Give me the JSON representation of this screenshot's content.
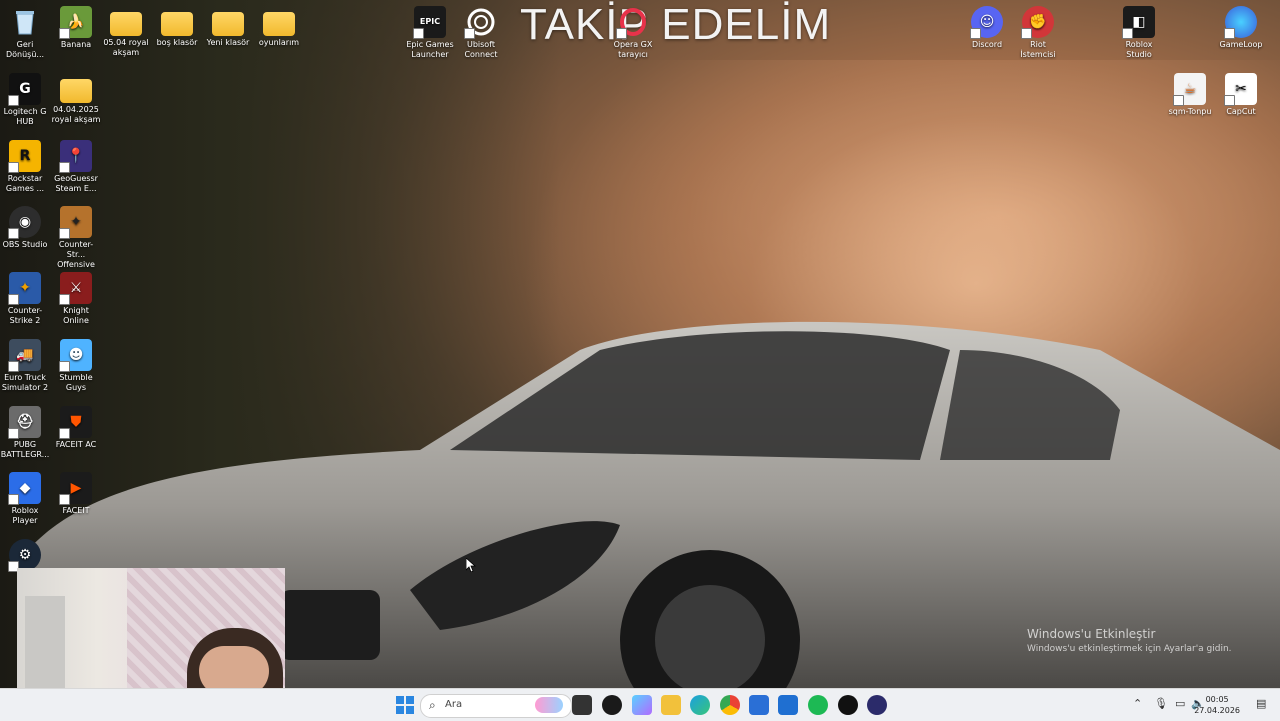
{
  "overlay_title": "TAKİP EDELİM",
  "desktop_icons": [
    {
      "label": "Geri Dönüşü...",
      "icon": "recycle-bin-icon"
    },
    {
      "label": "Banana",
      "icon": "banana-icon"
    },
    {
      "label": "05.04 royal akşam",
      "icon": "folder-icon"
    },
    {
      "label": "boş klasör",
      "icon": "folder-icon"
    },
    {
      "label": "Yeni klasör",
      "icon": "folder-icon"
    },
    {
      "label": "oyunlarım",
      "icon": "folder-icon"
    },
    {
      "label": "Epic Games Launcher",
      "icon": "epic-games-icon"
    },
    {
      "label": "Ubisoft Connect",
      "icon": "ubisoft-icon"
    },
    {
      "label": "Opera GX tarayıcı",
      "icon": "opera-gx-icon"
    },
    {
      "label": "Discord",
      "icon": "discord-icon"
    },
    {
      "label": "Riot İstemcisi",
      "icon": "riot-icon"
    },
    {
      "label": "Roblox Studio",
      "icon": "roblox-studio-icon"
    },
    {
      "label": "GameLoop",
      "icon": "gameloop-icon"
    },
    {
      "label": "Logitech G HUB",
      "icon": "logitech-icon"
    },
    {
      "label": "04.04.2025 royal akşam",
      "icon": "folder-icon"
    },
    {
      "label": "sqm-Tonpu",
      "icon": "java-icon"
    },
    {
      "label": "CapCut",
      "icon": "capcut-icon"
    },
    {
      "label": "Rockstar Games ...",
      "icon": "rockstar-icon"
    },
    {
      "label": "GeoGuessr Steam E...",
      "icon": "geoguessr-icon"
    },
    {
      "label": "OBS Studio",
      "icon": "obs-icon"
    },
    {
      "label": "Counter-Str... Offensive",
      "icon": "csgo-icon"
    },
    {
      "label": "Counter-Strike 2",
      "icon": "cs2-icon"
    },
    {
      "label": "Knight Online",
      "icon": "knight-online-icon"
    },
    {
      "label": "Euro Truck Simulator 2",
      "icon": "ets2-icon"
    },
    {
      "label": "Stumble Guys",
      "icon": "stumble-guys-icon"
    },
    {
      "label": "PUBG BATTLEGR...",
      "icon": "pubg-icon"
    },
    {
      "label": "FACEIT AC",
      "icon": "faceit-ac-icon"
    },
    {
      "label": "Roblox Player",
      "icon": "roblox-player-icon"
    },
    {
      "label": "FACEIT",
      "icon": "faceit-icon"
    }
  ],
  "activation": {
    "title": "Windows'u Etkinleştir",
    "subtitle": "Windows'u etkinleştirmek için Ayarlar'a gidin."
  },
  "taskbar": {
    "search_placeholder": "Ara",
    "clock_time": "00:05",
    "clock_date": "27.04.2026"
  }
}
